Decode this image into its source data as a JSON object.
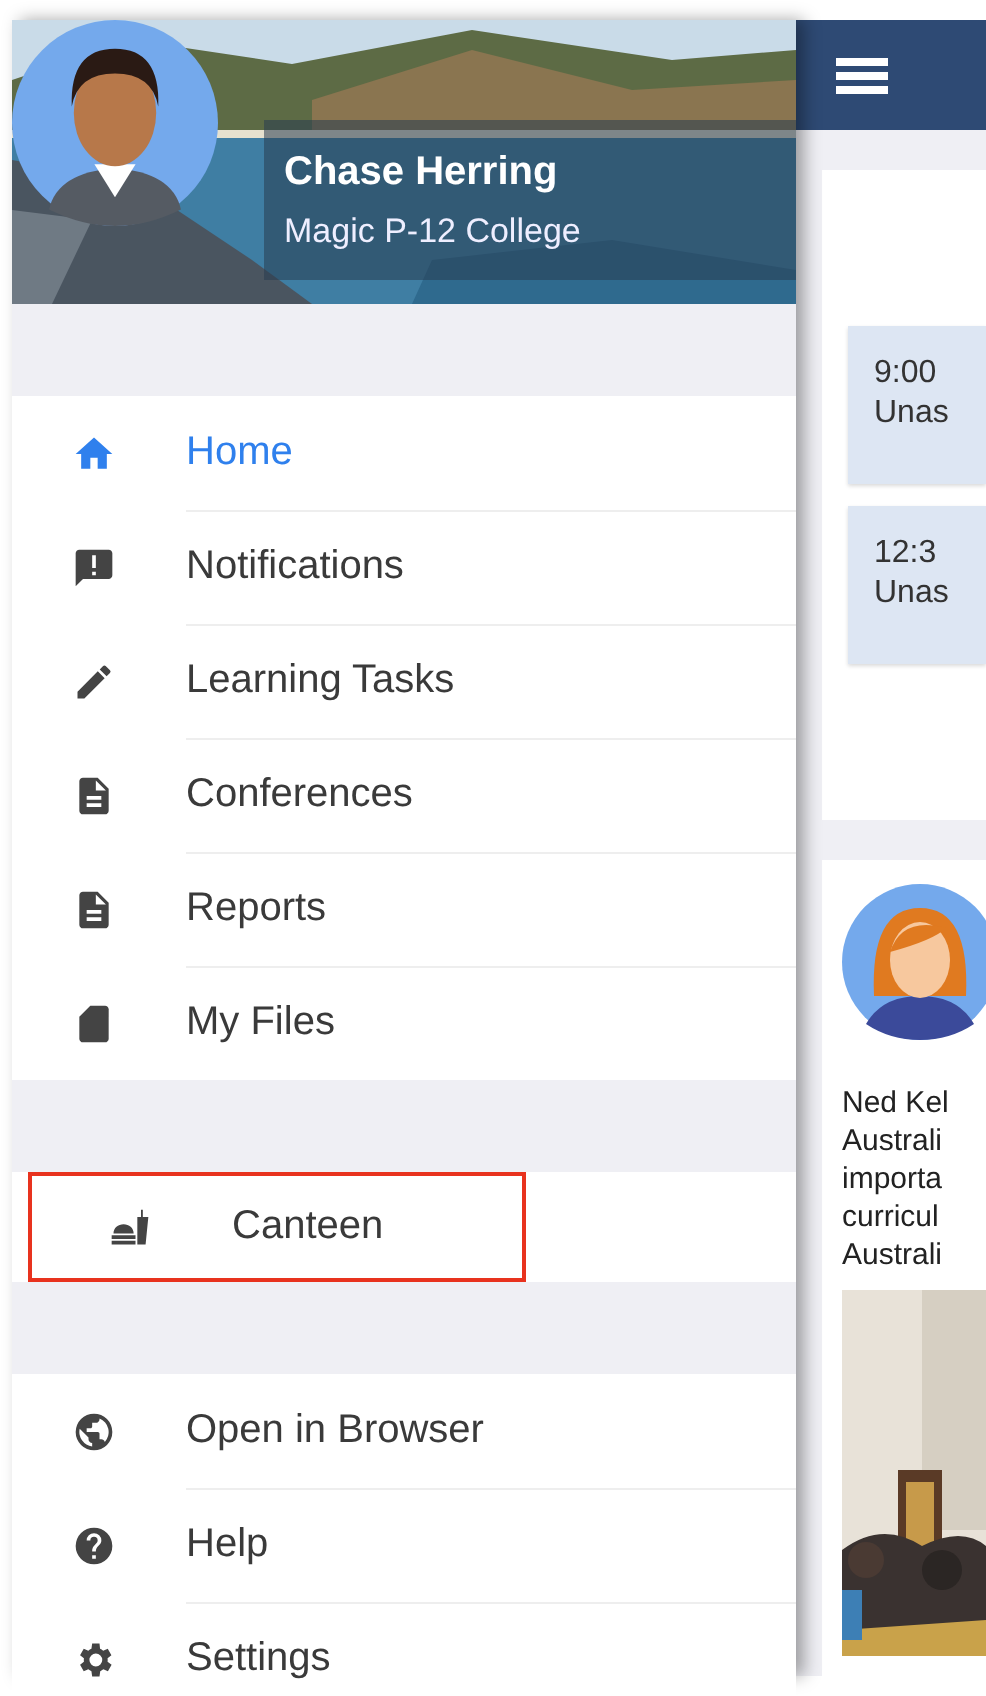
{
  "profile": {
    "name": "Chase Herring",
    "school": "Magic P-12 College"
  },
  "menu_sections": [
    {
      "highlighted": false,
      "items": [
        {
          "kind": "home",
          "label": "Home",
          "selected": true
        },
        {
          "kind": "alert",
          "label": "Notifications",
          "selected": false
        },
        {
          "kind": "pencil",
          "label": "Learning Tasks",
          "selected": false
        },
        {
          "kind": "document",
          "label": "Conferences",
          "selected": false
        },
        {
          "kind": "document",
          "label": "Reports",
          "selected": false
        },
        {
          "kind": "card",
          "label": "My Files",
          "selected": false
        }
      ]
    },
    {
      "highlighted": true,
      "items": [
        {
          "kind": "food",
          "label": "Canteen",
          "selected": false
        }
      ]
    },
    {
      "highlighted": false,
      "items": [
        {
          "kind": "globe",
          "label": "Open in Browser",
          "selected": false
        },
        {
          "kind": "help",
          "label": "Help",
          "selected": false
        },
        {
          "kind": "gear",
          "label": "Settings",
          "selected": false
        }
      ]
    }
  ],
  "main": {
    "appointments": [
      {
        "time": "9:00",
        "detail": "Unas"
      },
      {
        "time": "12:3",
        "detail": "Unas"
      }
    ],
    "post": {
      "lines": [
        "Ned Kel",
        "Australi",
        "importa",
        "curricul",
        "Australi"
      ],
      "image": {
        "kind": "picture"
      }
    }
  }
}
